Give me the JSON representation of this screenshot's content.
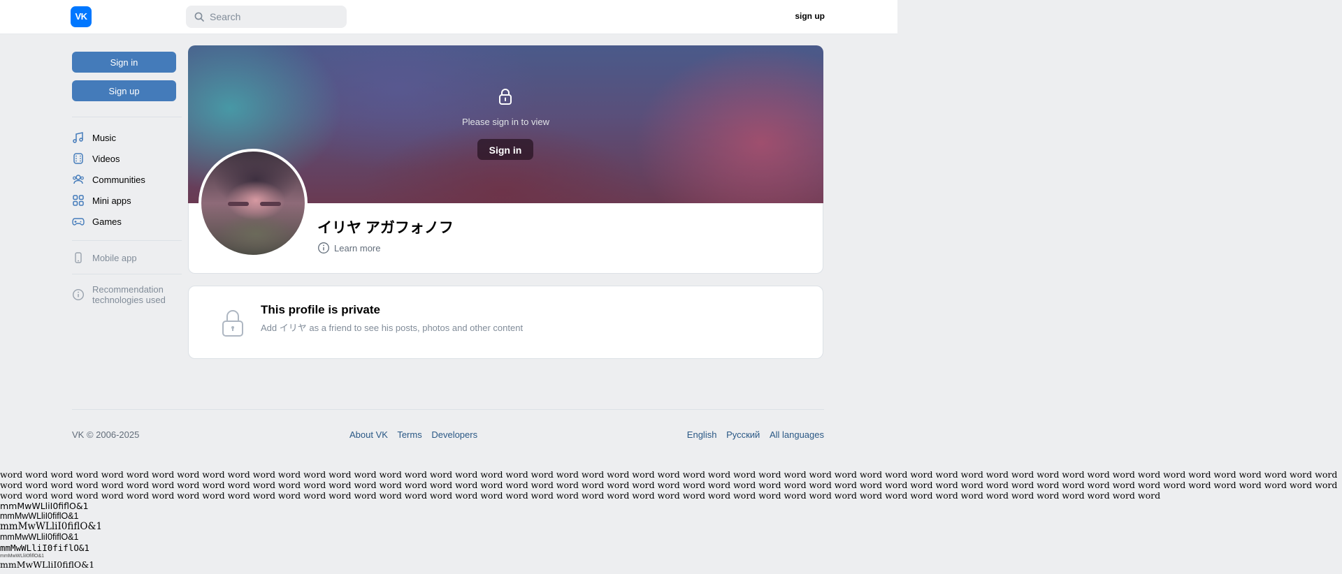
{
  "header": {
    "logo_text": "VK",
    "search_placeholder": "Search",
    "signup_label": "sign up"
  },
  "sidebar": {
    "signin_label": "Sign in",
    "signup_label": "Sign up",
    "nav": [
      {
        "label": "Music",
        "icon": "music-note-icon"
      },
      {
        "label": "Videos",
        "icon": "video-icon"
      },
      {
        "label": "Communities",
        "icon": "users-icon"
      },
      {
        "label": "Mini apps",
        "icon": "grid-icon"
      },
      {
        "label": "Games",
        "icon": "gamepad-icon"
      }
    ],
    "mobile_app_label": "Mobile app",
    "recommendation_line1": "Recommendation",
    "recommendation_line2": "technologies used"
  },
  "cover": {
    "prompt_text": "Please sign in to view",
    "signin_label": "Sign in"
  },
  "profile": {
    "name": "イリヤ アガフォノフ",
    "learn_more_label": "Learn more"
  },
  "private_notice": {
    "title": "This profile is private",
    "subtitle": "Add イリヤ as a friend to see his posts, photos and other content"
  },
  "footer": {
    "copyright": "VK © 2006-2025",
    "links": [
      "About VK",
      "Terms",
      "Developers"
    ],
    "languages": [
      "English",
      "Русский",
      "All languages"
    ]
  },
  "debug": {
    "words_line": "word word word word word word word word word word word word word word word word word word word word word word word word word word word word word word word word word word word word word word word word word word word word word word word word word word word word word word word word word word word word word word word word word word word word word word word word word word word word word word word word word word word word word word word word word word word word word word word word word word word word word word word word word word word word word word word word word word word word word word word word word word word word word word word word word word word word word word word word word word word word word word word word word word word word word word word word",
    "samples": [
      "mmMwWLliI0fiflO&1",
      "mmMwWLliI0fiflO&1",
      "mmMwWLliI0fiflO&1",
      "mmMwWLliI0fiflO&1",
      "mmMwWLliI0fiflO&1",
      "mmMwWLliI0fiflO&1",
      "mmMwWLliI0fiflO&1"
    ]
  }
}
